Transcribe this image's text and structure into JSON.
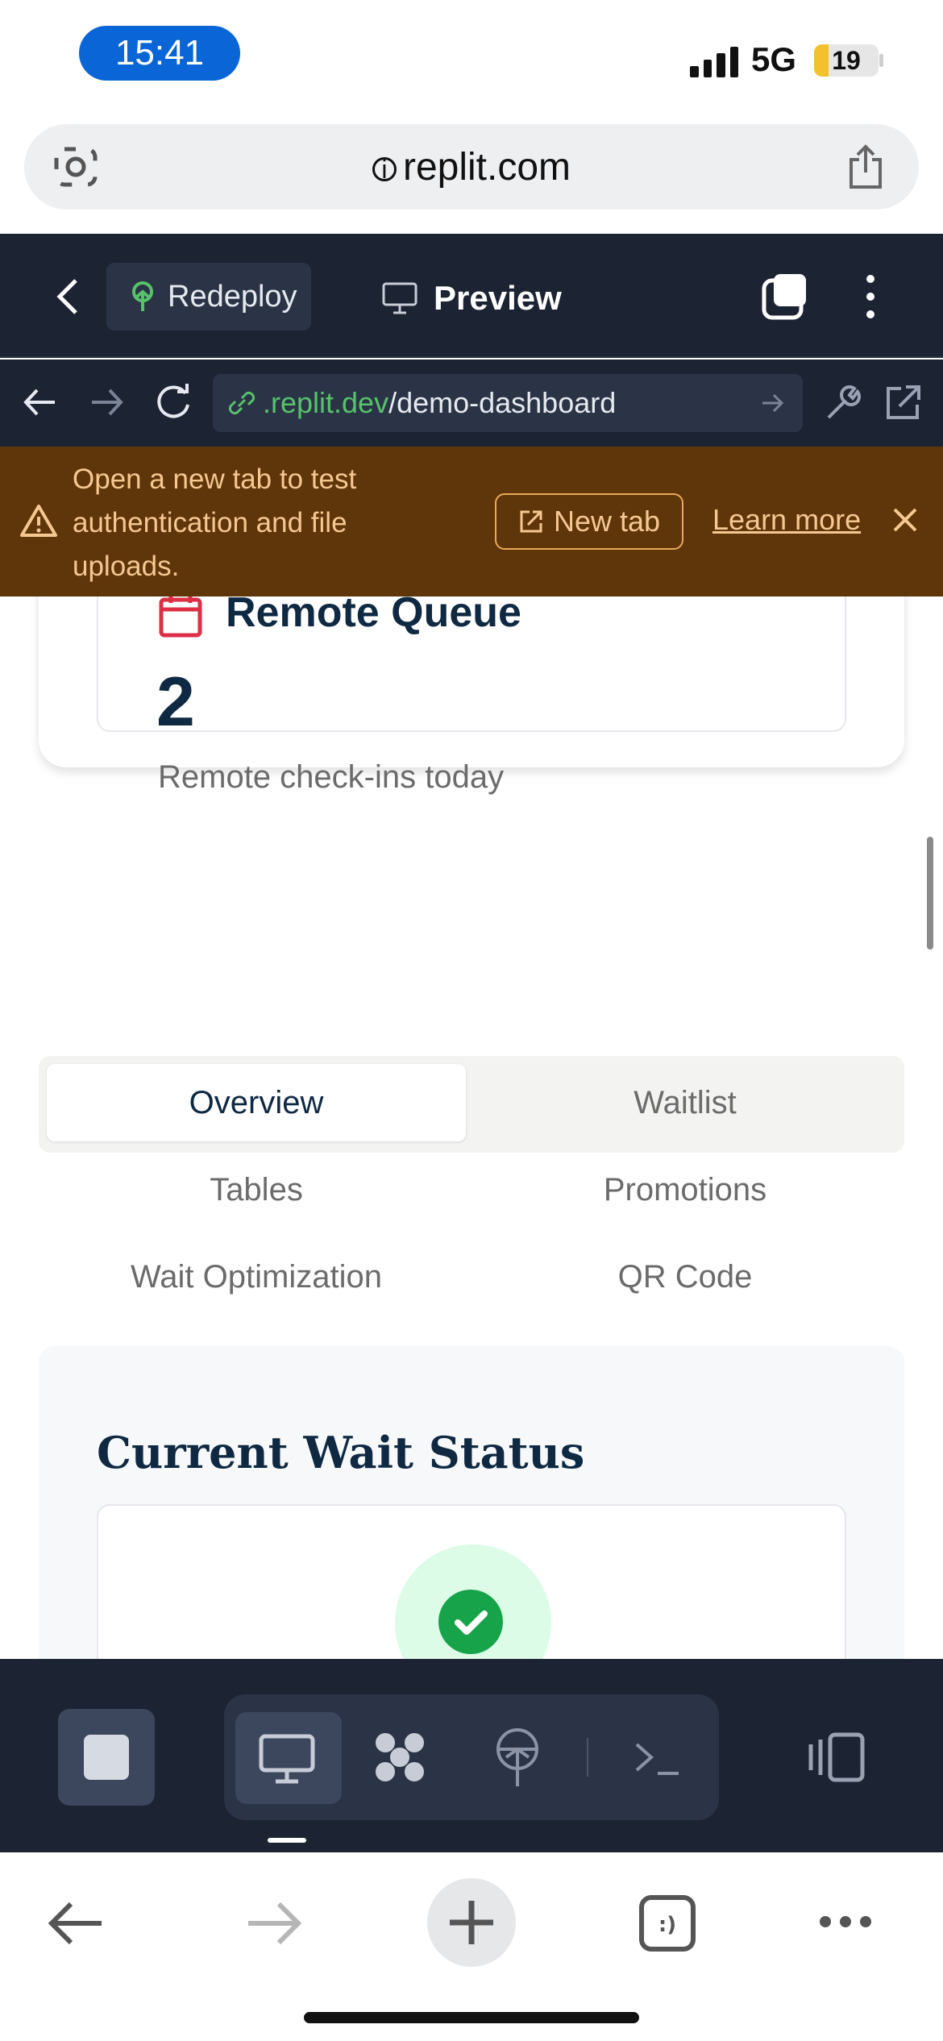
{
  "status_bar": {
    "time": "15:41",
    "network": "5G",
    "battery": "19"
  },
  "browser": {
    "domain": "replit.com"
  },
  "replit_header": {
    "redeploy_label": "Redeploy",
    "preview_label": "Preview"
  },
  "webview_bar": {
    "url_host": ".replit.dev",
    "url_path": "/demo-dashboard"
  },
  "banner": {
    "message": "Open a new tab to test authentication and file uploads.",
    "new_tab_label": "New tab",
    "learn_more_label": "Learn more"
  },
  "remote_queue": {
    "title": "Remote Queue",
    "count": "2",
    "subtitle": "Remote check-ins today"
  },
  "tabs": {
    "overview": "Overview",
    "waitlist": "Waitlist",
    "tables": "Tables",
    "promotions": "Promotions",
    "wait_optimization": "Wait Optimization",
    "qr_code": "QR Code"
  },
  "wait_status": {
    "title": "Current Wait Status"
  },
  "icons": {
    "lens": "camera-search-icon",
    "share": "share-icon",
    "back": "chevron-left-icon",
    "redeploy": "deploy-icon",
    "preview": "monitor-icon",
    "windows": "windows-icon",
    "more": "kebab-icon",
    "calendar": "calendar-icon",
    "check": "check-icon",
    "warning": "warning-icon",
    "external": "external-link-icon"
  },
  "colors": {
    "accent_green": "#57c26a",
    "banner_bg": "#5f3609",
    "banner_text": "#f5c892",
    "header_bg": "#1c2333",
    "navy": "#0f2942",
    "success": "#16a34a"
  }
}
